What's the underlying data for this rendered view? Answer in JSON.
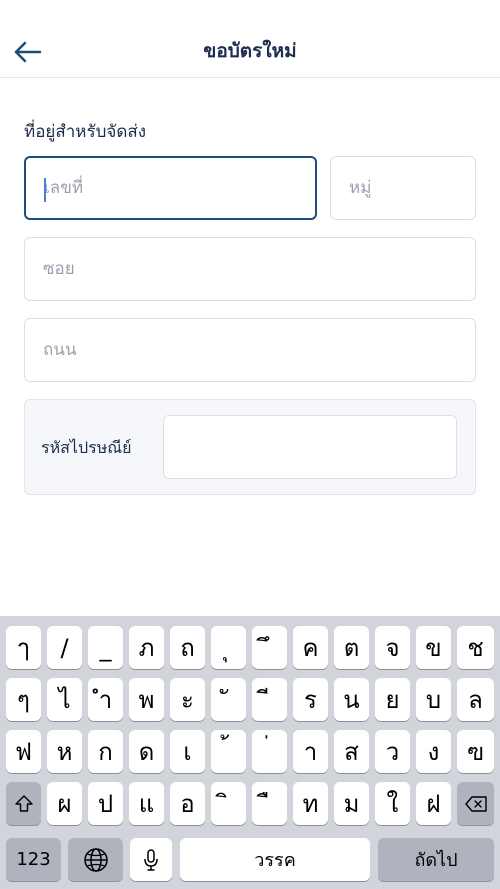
{
  "header": {
    "title": "ขอบัตรใหม่",
    "back_icon": "arrow-left-icon"
  },
  "form": {
    "section_label": "ที่อยู่สำหรับจัดส่ง",
    "house_no_placeholder": "เลขที่",
    "moo_placeholder": "หมู่",
    "soi_placeholder": "ซอย",
    "road_placeholder": "ถนน",
    "postal_label": "รหัสไปรษณีย์",
    "postal_value": ""
  },
  "keyboard": {
    "row1": [
      "ๅ",
      "/",
      "_",
      "ภ",
      "ถ",
      "ุ",
      "ึ",
      "ค",
      "ต",
      "จ",
      "ข",
      "ช"
    ],
    "row2": [
      "ๆ",
      "ไ",
      "ำ",
      "พ",
      "ะ",
      "ั",
      "ี",
      "ร",
      "น",
      "ย",
      "บ",
      "ล"
    ],
    "row3": [
      "ฟ",
      "ห",
      "ก",
      "ด",
      "เ",
      "้",
      "่",
      "า",
      "ส",
      "ว",
      "ง",
      "ฃ"
    ],
    "row4": [
      "ผ",
      "ป",
      "แ",
      "อ",
      "ิ",
      "ื",
      "ท",
      "ม",
      "ใ",
      "ฝ"
    ],
    "shift_icon": "shift-icon",
    "delete_icon": "backspace-icon",
    "numbers_label": "123",
    "globe_icon": "globe-icon",
    "mic_icon": "microphone-icon",
    "space_label": "วรรค",
    "next_label": "ถัดไป"
  }
}
